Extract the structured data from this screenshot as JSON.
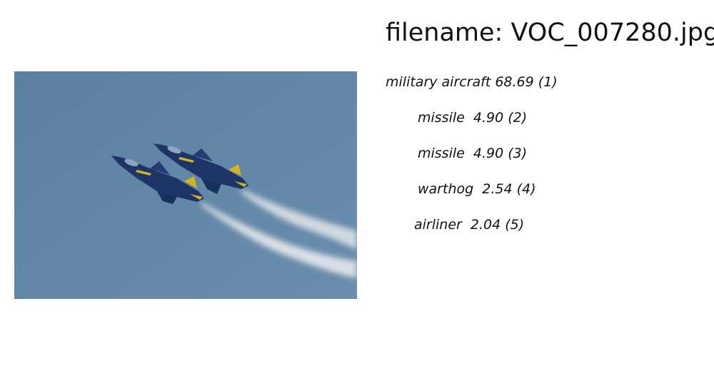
{
  "filename_label": "filename: VOC_007280.jpg",
  "predictions": [
    {
      "text": "military aircraft 68.69 (1)"
    },
    {
      "text": "missile  4.90 (2)"
    },
    {
      "text": "missile  4.90 (3)"
    },
    {
      "text": "warthog  2.54 (4)"
    },
    {
      "text": "airliner  2.04 (5)"
    }
  ],
  "colors": {
    "sky": "#6286a5",
    "jet_body": "#1d3566",
    "jet_accent": "#d6b21e",
    "smoke": "#e3e6e9"
  }
}
